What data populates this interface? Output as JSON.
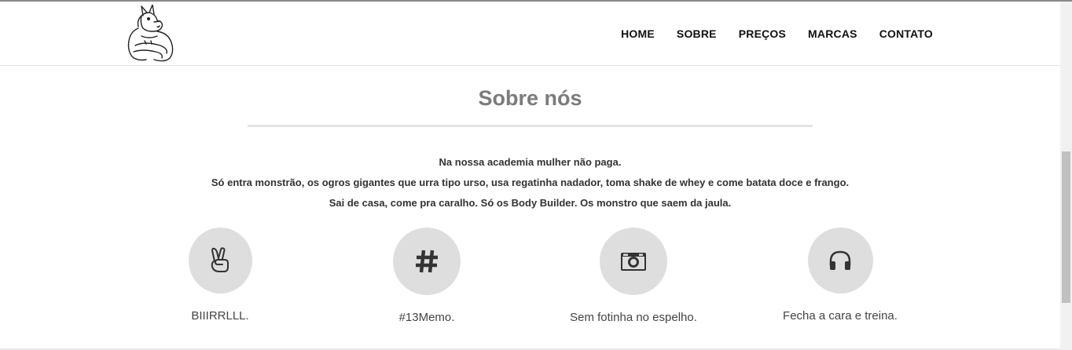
{
  "header": {
    "logo": "donkey-bodybuilder-logo",
    "nav": [
      "HOME",
      "SOBRE",
      "PREÇOS",
      "MARCAS",
      "CONTATO"
    ]
  },
  "about": {
    "title": "Sobre nós",
    "lines": [
      "Na nossa academia mulher não paga.",
      "Só entra monstrão, os ogros gigantes que urra tipo urso, usa regatinha nadador, toma shake de whey e come batata doce e frango.",
      "Sai de casa, come pra caralho. Só os Body Builder. Os monstro que saem da jaula."
    ]
  },
  "features": [
    {
      "icon": "peace-hand-icon",
      "label": "BIIIRRLLL."
    },
    {
      "icon": "hashtag-icon",
      "label": "#13Memo."
    },
    {
      "icon": "camera-icon",
      "label": "Sem fotinha no espelho."
    },
    {
      "icon": "headphones-icon",
      "label": "Fecha a cara e treina."
    }
  ],
  "colors": {
    "title": "#7b7b7b",
    "circle": "#dedede",
    "icon": "#333333"
  }
}
